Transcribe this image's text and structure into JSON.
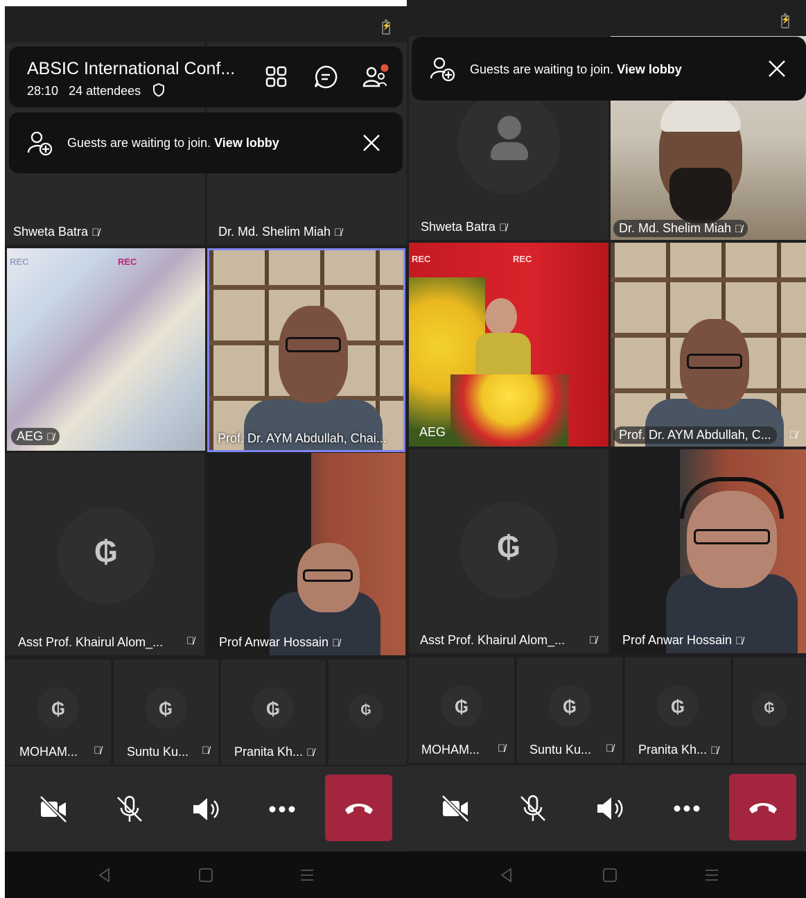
{
  "meeting": {
    "title": "ABSIC International Conf...",
    "elapsed": "28:10",
    "attendees": "24 attendees"
  },
  "lobby": {
    "text": "Guests are waiting to join.",
    "link": "View lobby"
  },
  "left": {
    "tiles": {
      "shweta": "Shweta Batra",
      "shelim": "Dr. Md. Shelim Miah",
      "aeg": "AEG",
      "abdullah": "Prof. Dr. AYM Abdullah, Chai...",
      "khairul": "Asst Prof. Khairul Alom_...",
      "anwar": "Prof Anwar Hossain",
      "moham": "MOHAM...",
      "suntu": "Suntu Ku...",
      "pranita": "Pranita Kh..."
    }
  },
  "right": {
    "tiles": {
      "shweta": "Shweta Batra",
      "shelim": "Dr. Md. Shelim Miah",
      "aeg": "AEG",
      "abdullah": "Prof. Dr. AYM Abdullah, C...",
      "khairul": "Asst Prof. Khairul Alom_...",
      "anwar": "Prof Anwar Hossain",
      "moham": "MOHAM...",
      "suntu": "Suntu Ku...",
      "pranita": "Pranita Kh..."
    }
  },
  "rec_label": "REC",
  "icons": {
    "mic_off": "mic-off-icon",
    "camera_off": "camera-off-icon",
    "speaker": "speaker-icon",
    "more": "more-icon",
    "hangup": "hangup-icon",
    "grid": "grid-view-icon",
    "chat": "chat-icon",
    "people": "people-icon",
    "add_person": "add-person-icon",
    "close": "close-icon"
  },
  "colors": {
    "hangup": "#a4253e",
    "selected_border": "#7f85f5",
    "notification_dot": "#e0533a"
  }
}
